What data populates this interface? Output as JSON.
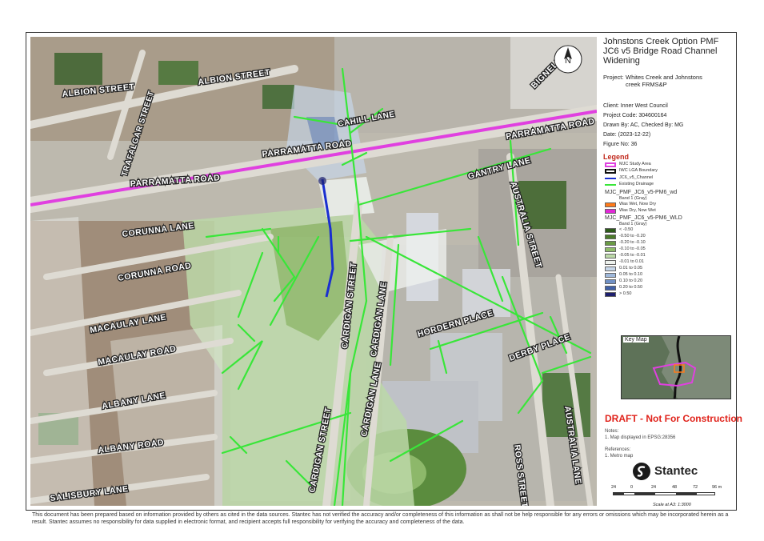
{
  "title": {
    "line1": "Johnstons Creek Option PMF",
    "line2": "JC6 v5 Bridge Road Channel",
    "line3": "Widening"
  },
  "project": {
    "label": "Project:",
    "value_line1": "Whites Creek and Johnstons",
    "value_line2": "creek FRMS&P"
  },
  "client": "Client: Inner West Council",
  "project_code": "Project Code: 304600164",
  "drawn_by": "Drawn By: AC, Checked By: MG",
  "date": "Date: (2023-12-22)",
  "figure_no": "Figure No: 36",
  "legend": {
    "title": "Legend",
    "layers": [
      {
        "label": "MJC Study Area",
        "color": "#e040e0",
        "kind": "outline"
      },
      {
        "label": "IWC LGA Boundary",
        "color": "#111111",
        "kind": "thick"
      },
      {
        "label": "JC6_v5_Channel",
        "color": "#1a2fd0",
        "kind": "line"
      },
      {
        "label": "Existing Drainage",
        "color": "#39e639",
        "kind": "line"
      }
    ],
    "wd_head": "MJC_PMF_JC6_v5-PM6_wd",
    "wd_band": "Band 1 (Gray)",
    "wd_items": [
      {
        "label": "Was Wet, Now Dry",
        "color": "#ff7a1a"
      },
      {
        "label": "Was Dry, Now Wet",
        "color": "#e02ad6"
      }
    ],
    "wld_head": "MJC_PMF_JC6_v5-PM6_WLD",
    "wld_band": "Band 1 (Gray)",
    "wld_items": [
      {
        "label": "< -0.50",
        "color": "#2d5a1a"
      },
      {
        "label": "-0.50 to -0.20",
        "color": "#4a7a2a"
      },
      {
        "label": "-0.20 to -0.10",
        "color": "#6a9a45"
      },
      {
        "label": "-0.10 to -0.05",
        "color": "#8fbb6a"
      },
      {
        "label": "-0.05 to -0.01",
        "color": "#bcd9a8"
      },
      {
        "label": "-0.01 to 0.01",
        "color": "#eef2ee"
      },
      {
        "label": "0.01 to 0.05",
        "color": "#c7d7ea"
      },
      {
        "label": "0.05 to 0.10",
        "color": "#9fb8da"
      },
      {
        "label": "0.10 to 0.20",
        "color": "#7090c4"
      },
      {
        "label": "0.20 to 0.50",
        "color": "#3f5fa6"
      },
      {
        "label": "> 0.50",
        "color": "#1d1f6e"
      }
    ]
  },
  "key_map": {
    "label": "Key Map"
  },
  "draft": "DRAFT - Not For Construction",
  "notes": {
    "label": "Notes:",
    "item1": "1. Map displayed in EPSG:28356"
  },
  "references": {
    "label": "References:",
    "item1": "1. Metro map"
  },
  "logo": {
    "name": "Stantec",
    "icon": "stantec-logo-icon"
  },
  "scale": {
    "ticks": [
      "24",
      "0",
      "24",
      "48",
      "72",
      "96 m"
    ],
    "text": "Scale at A3: 1:3000"
  },
  "north_arrow": {
    "letter": "N",
    "icon": "north-arrow-icon"
  },
  "disclaimer": "This document has been prepared based on information provided by others as cited in the data sources. Stantec has not verified the accuracy and/or completeness of this information as shall not be help responsible for any errors or omissions which may be incorporated herein as a result. Stantec assumes no responsibility for data supplied in electronic format, and recipient accepts full responsibility for verifying the accuracy and completeness of the data.",
  "streets": {
    "albion1": "ALBION STREET",
    "albion2": "ALBION STREET",
    "trafalgar": "TRAFALGAR STREET",
    "cahill": "CAHILL LANE",
    "parramatta1": "PARRAMATTA ROAD",
    "parramatta2": "PARRAMATTA ROAD",
    "parramatta3": "PARRAMATTA ROAD",
    "bignell": "BIGNELL",
    "gantry": "GANTRY LANE",
    "australia_st": "AUSTRALIA STREET",
    "corunna_lane": "CORUNNA LANE",
    "corunna_road": "CORUNNA ROAD",
    "cardigan_st1": "CARDIGAN STREET",
    "cardigan_lane1": "CARDIGAN LANE",
    "hordern": "HORDERN PLACE",
    "macaulay_lane": "MACAULAY LANE",
    "macaulay_road": "MACAULAY ROAD",
    "derby": "DERBY PLACE",
    "albany_lane": "ALBANY LANE",
    "albany_road": "ALBANY ROAD",
    "cardigan_st2": "CARDIGAN STREET",
    "cardigan_lane2": "CARDIGAN LANE",
    "ross": "ROSS STREET",
    "australia_lane": "AUSTRALIA LANE",
    "salisbury": "SALISBURY LANE"
  },
  "colors": {
    "study_area": "#e040e0",
    "drainage": "#39e639",
    "channel": "#1a2fd0",
    "draft": "#e0231b"
  }
}
